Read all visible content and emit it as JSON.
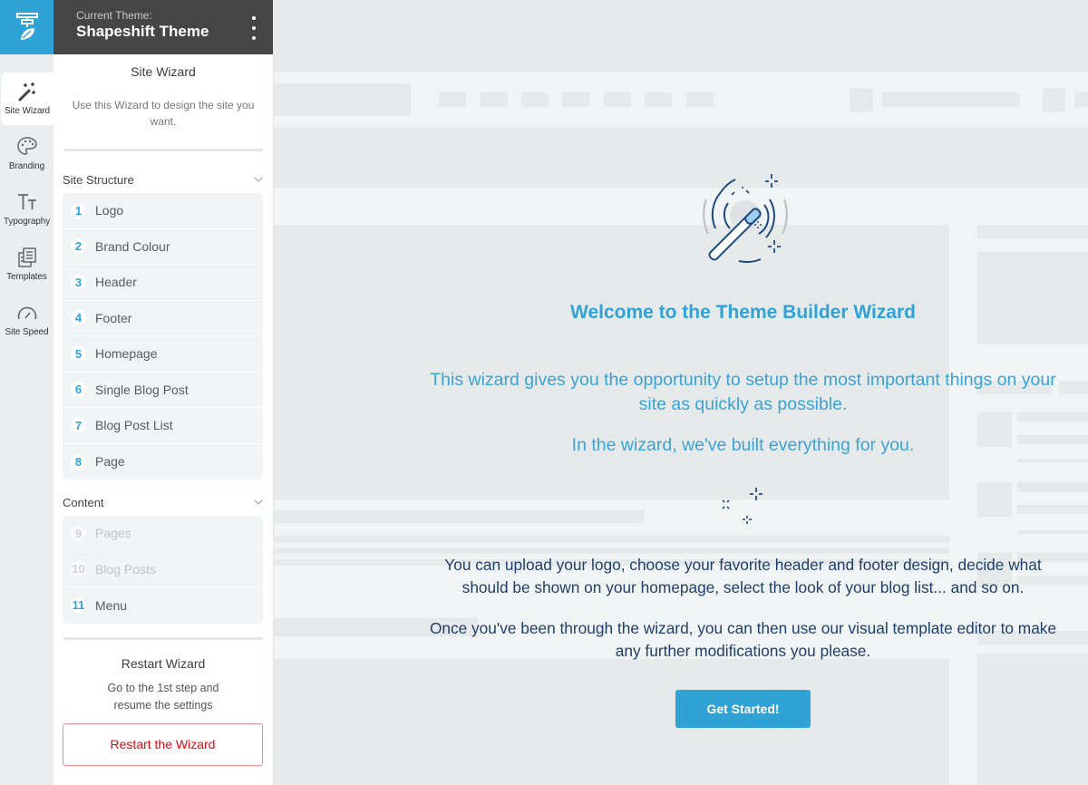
{
  "app": {
    "brand_icon": "theme-builder-logo-icon",
    "accent_color": "#2fa2d6",
    "danger_color": "#e30613"
  },
  "rail": {
    "items": [
      {
        "label": "Site Wizard",
        "icon": "magic-wand-icon",
        "active": true
      },
      {
        "label": "Branding",
        "icon": "palette-icon",
        "active": false
      },
      {
        "label": "Typography",
        "icon": "typography-icon",
        "active": false
      },
      {
        "label": "Templates",
        "icon": "templates-icon",
        "active": false
      },
      {
        "label": "Site Speed",
        "icon": "speedometer-icon",
        "active": false
      }
    ]
  },
  "panel": {
    "header": {
      "current_label": "Current Theme:",
      "theme_name": "Shapeshift Theme",
      "menu_icon": "kebab-menu-icon"
    },
    "title": "Site Wizard",
    "description": "Use this Wizard to design the site you want.",
    "sections": [
      {
        "title": "Site Structure",
        "steps": [
          {
            "num": "1",
            "label": "Logo",
            "enabled": true
          },
          {
            "num": "2",
            "label": "Brand Colour",
            "enabled": true
          },
          {
            "num": "3",
            "label": "Header",
            "enabled": true
          },
          {
            "num": "4",
            "label": "Footer",
            "enabled": true
          },
          {
            "num": "5",
            "label": "Homepage",
            "enabled": true
          },
          {
            "num": "6",
            "label": "Single Blog Post",
            "enabled": true
          },
          {
            "num": "7",
            "label": "Blog Post List",
            "enabled": true
          },
          {
            "num": "8",
            "label": "Page",
            "enabled": true
          }
        ]
      },
      {
        "title": "Content",
        "steps": [
          {
            "num": "9",
            "label": "Pages",
            "enabled": false
          },
          {
            "num": "10",
            "label": "Blog Posts",
            "enabled": false
          },
          {
            "num": "11",
            "label": "Menu",
            "enabled": true
          }
        ]
      }
    ],
    "restart": {
      "title": "Restart Wizard",
      "description_line1": "Go to the 1st step and",
      "description_line2": "resume the settings",
      "button_label": "Restart the Wizard"
    }
  },
  "main": {
    "hero_icon": "magic-wand-illustration",
    "title": "Welcome to the Theme Builder Wizard",
    "lead": "This wizard gives you the opportunity to setup the most important things on your site as quickly as possible.",
    "lead2": "In the wizard, we've built everything for you.",
    "sparkles_icon": "sparkles-icon",
    "body1": "You can upload your logo, choose your favorite header and footer design, decide what should be shown on your homepage, select the look of your blog list... and so on.",
    "body2": "Once you've been through the wizard, you can then use our visual template editor to make any further modifications you please.",
    "cta_label": "Get Started!"
  }
}
